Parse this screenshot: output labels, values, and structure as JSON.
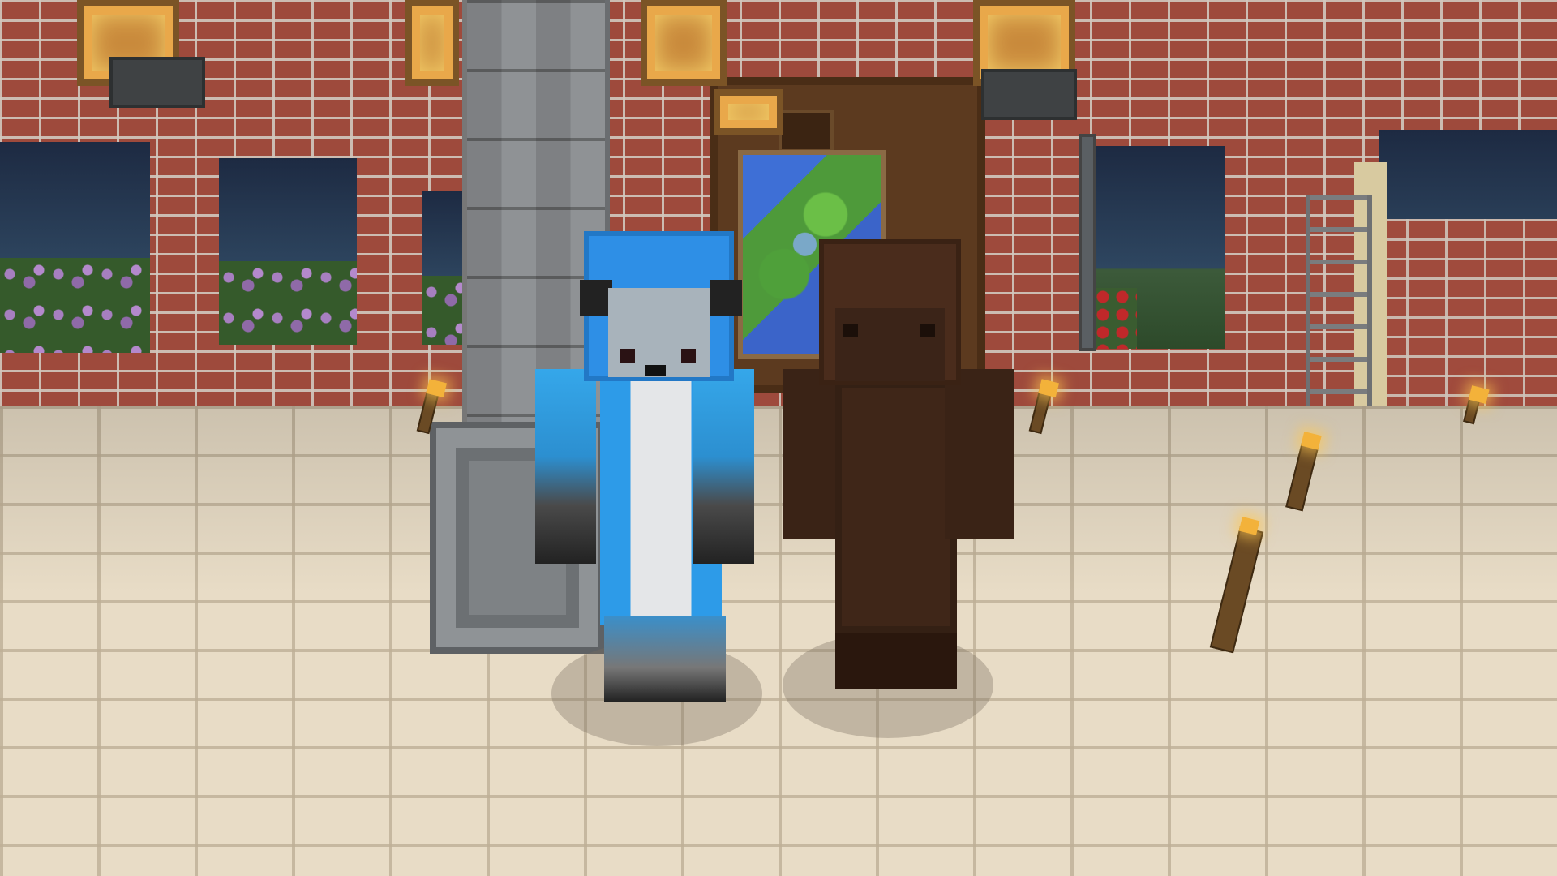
{
  "scene": {
    "description_type": "game-world-view",
    "palette": {
      "brick": "#9e4a3c",
      "mortar": "#d2c8be",
      "floor": "#e8dcc6",
      "stone": "#8f9295",
      "sky": "#2b3a55",
      "fox_blue": "#2e8fe6",
      "gorilla_brown": "#4a2c1c",
      "torch_flame": "#f3b23a"
    },
    "characters": [
      {
        "id": "blue-fox-player",
        "icon": "fox-skin"
      },
      {
        "id": "brown-gorilla-player",
        "icon": "gorilla-skin"
      }
    ]
  }
}
